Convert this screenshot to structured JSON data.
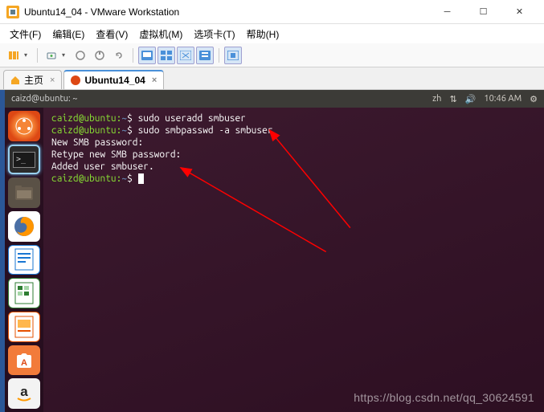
{
  "titlebar": {
    "title": "Ubuntu14_04 - VMware Workstation"
  },
  "menus": {
    "file": "文件(F)",
    "edit": "编辑(E)",
    "view": "查看(V)",
    "vm": "虚拟机(M)",
    "tabs": "选项卡(T)",
    "help": "帮助(H)"
  },
  "tabs": {
    "home": "主页",
    "vm_name": "Ubuntu14_04"
  },
  "ubuntu_panel": {
    "window_title": "caizd@ubuntu: ~",
    "lang": "zh",
    "time": "10:46 AM"
  },
  "terminal": {
    "user": "caizd@ubuntu",
    "path": "~",
    "lines": {
      "cmd1": "sudo useradd smbuser",
      "cmd2": "sudo smbpasswd -a smbuser",
      "out1": "New SMB password:",
      "out2": "Retype new SMB password:",
      "out3": "Added user smbuser."
    }
  },
  "watermark": "https://blog.csdn.net/qq_30624591"
}
